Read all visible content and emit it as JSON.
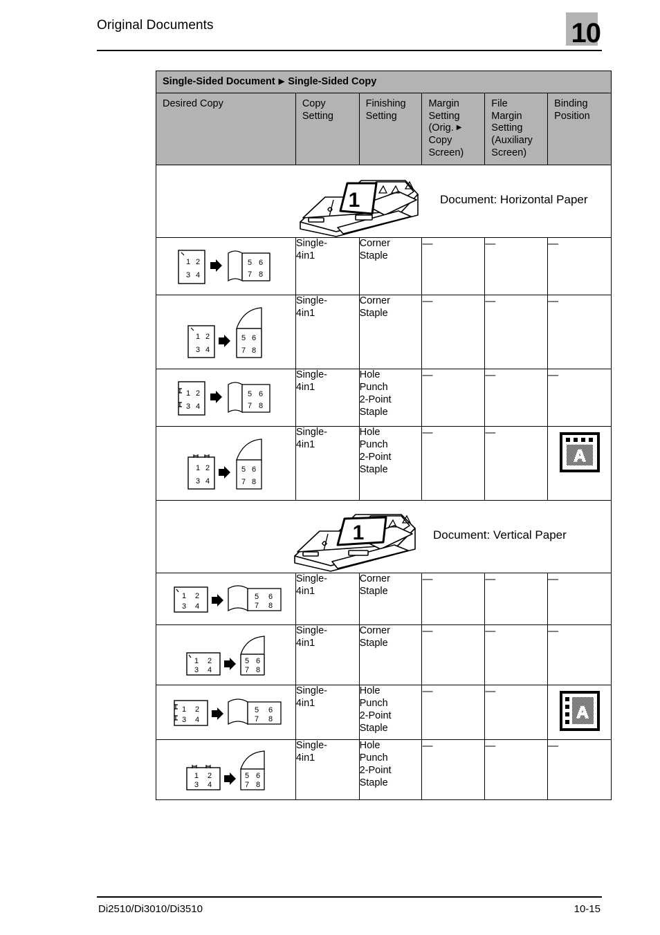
{
  "header": {
    "title": "Original Documents",
    "chapter": "10"
  },
  "footer": {
    "models": "Di2510/Di3010/Di3510",
    "page": "10-15"
  },
  "table": {
    "band_title_part1": "Single-Sided Document",
    "band_arrow": "▶",
    "band_title_part2": "Single-Sided Copy",
    "columns": [
      {
        "label": "Desired Copy"
      },
      {
        "label": "Copy\nSetting",
        "line1": "Copy",
        "line2": "Setting"
      },
      {
        "label": "Finishing\nSetting",
        "line1": "Finishing",
        "line2": "Setting"
      },
      {
        "line1": "Margin",
        "line2": "Setting",
        "line3": "(Orig.",
        "arrow": "▶",
        "line4": "Copy",
        "line5": "Screen)"
      },
      {
        "line1": "File",
        "line2": "Margin",
        "line3": "Setting",
        "line4": "(Auxiliary",
        "line5": "Screen)"
      },
      {
        "line1": "Binding",
        "line2": "Position"
      }
    ],
    "sections": [
      {
        "illustration": {
          "name": "document-feeder-horizontal",
          "page_number": "1",
          "label": "Document: Horizontal Paper"
        },
        "rows": [
          {
            "diagram": {
              "source": {
                "orientation": "portrait",
                "numbers": [
                  "1",
                  "2",
                  "3",
                  "4"
                ],
                "mark": "corner-staple-top-left"
              },
              "arrow": "➡",
              "output": {
                "style": "side-fold",
                "orientation": "portrait",
                "numbers": [
                  "5",
                  "6",
                  "7",
                  "8"
                ]
              }
            },
            "copy_setting": "Single-4in1",
            "copy_setting_l1": "Single-",
            "copy_setting_l2": "4in1",
            "finishing_setting": [
              "Corner",
              "Staple"
            ],
            "margin_setting": "—",
            "file_margin_setting": "—",
            "binding_position": "—"
          },
          {
            "diagram": {
              "source": {
                "orientation": "portrait",
                "numbers": [
                  "1",
                  "2",
                  "3",
                  "4"
                ],
                "mark": "corner-staple-top-left"
              },
              "arrow": "➡",
              "output": {
                "style": "top-fold",
                "orientation": "portrait",
                "numbers": [
                  "5",
                  "6",
                  "7",
                  "8"
                ]
              }
            },
            "copy_setting_l1": "Single-",
            "copy_setting_l2": "4in1",
            "finishing_setting": [
              "Corner",
              "Staple"
            ],
            "margin_setting": "—",
            "file_margin_setting": "—",
            "binding_position": "—"
          },
          {
            "diagram": {
              "source": {
                "orientation": "portrait",
                "numbers": [
                  "1",
                  "2",
                  "3",
                  "4"
                ],
                "mark": "two-point-staple-left"
              },
              "arrow": "➡",
              "output": {
                "style": "side-fold",
                "orientation": "portrait",
                "numbers": [
                  "5",
                  "6",
                  "7",
                  "8"
                ]
              }
            },
            "copy_setting_l1": "Single-",
            "copy_setting_l2": "4in1",
            "finishing_setting": [
              "Hole",
              "Punch",
              "2-Point",
              "Staple"
            ],
            "margin_setting": "—",
            "file_margin_setting": "—",
            "binding_position": "—"
          },
          {
            "diagram": {
              "source": {
                "orientation": "portrait",
                "numbers": [
                  "1",
                  "2",
                  "3",
                  "4"
                ],
                "mark": "two-point-staple-top"
              },
              "arrow": "➡",
              "output": {
                "style": "top-fold",
                "orientation": "portrait",
                "numbers": [
                  "5",
                  "6",
                  "7",
                  "8"
                ]
              }
            },
            "copy_setting_l1": "Single-",
            "copy_setting_l2": "4in1",
            "finishing_setting": [
              "Hole",
              "Punch",
              "2-Point",
              "Staple"
            ],
            "margin_setting": "—",
            "file_margin_setting": "—",
            "binding_position_icon": {
              "name": "binding-position-top",
              "letter": "A",
              "holes": "top",
              "hole_count": 4
            }
          }
        ]
      },
      {
        "illustration": {
          "name": "document-feeder-vertical",
          "page_number": "1",
          "label": "Document: Vertical Paper"
        },
        "rows": [
          {
            "diagram": {
              "source": {
                "orientation": "landscape",
                "numbers": [
                  "1",
                  "2",
                  "3",
                  "4"
                ],
                "mark": "corner-staple-top-left"
              },
              "arrow": "➡",
              "output": {
                "style": "side-fold",
                "orientation": "landscape",
                "numbers": [
                  "5",
                  "6",
                  "7",
                  "8"
                ]
              }
            },
            "copy_setting_l1": "Single-",
            "copy_setting_l2": "4in1",
            "finishing_setting": [
              "Corner",
              "Staple"
            ],
            "margin_setting": "—",
            "file_margin_setting": "—",
            "binding_position": "—"
          },
          {
            "diagram": {
              "source": {
                "orientation": "landscape",
                "numbers": [
                  "1",
                  "2",
                  "3",
                  "4"
                ],
                "mark": "corner-staple-top-left"
              },
              "arrow": "➡",
              "output": {
                "style": "top-fold",
                "orientation": "landscape",
                "numbers": [
                  "5",
                  "6",
                  "7",
                  "8"
                ]
              }
            },
            "copy_setting_l1": "Single-",
            "copy_setting_l2": "4in1",
            "finishing_setting": [
              "Corner",
              "Staple"
            ],
            "margin_setting": "—",
            "file_margin_setting": "—",
            "binding_position": "—"
          },
          {
            "diagram": {
              "source": {
                "orientation": "landscape",
                "numbers": [
                  "1",
                  "2",
                  "3",
                  "4"
                ],
                "mark": "two-point-staple-left"
              },
              "arrow": "➡",
              "output": {
                "style": "side-fold",
                "orientation": "landscape",
                "numbers": [
                  "5",
                  "6",
                  "7",
                  "8"
                ]
              }
            },
            "copy_setting_l1": "Single-",
            "copy_setting_l2": "4in1",
            "finishing_setting": [
              "Hole",
              "Punch",
              "2-Point",
              "Staple"
            ],
            "margin_setting": "—",
            "file_margin_setting": "—",
            "binding_position_icon": {
              "name": "binding-position-left",
              "letter": "A",
              "holes": "left",
              "hole_count": 4
            }
          },
          {
            "diagram": {
              "source": {
                "orientation": "landscape",
                "numbers": [
                  "1",
                  "2",
                  "3",
                  "4"
                ],
                "mark": "two-point-staple-top"
              },
              "arrow": "➡",
              "output": {
                "style": "top-fold",
                "orientation": "landscape",
                "numbers": [
                  "5",
                  "6",
                  "7",
                  "8"
                ]
              }
            },
            "copy_setting_l1": "Single-",
            "copy_setting_l2": "4in1",
            "finishing_setting": [
              "Hole",
              "Punch",
              "2-Point",
              "Staple"
            ],
            "margin_setting": "—",
            "file_margin_setting": "—",
            "binding_position": "—"
          }
        ]
      }
    ]
  },
  "colors": {
    "header_gray": "#b3b3b3",
    "rule": "#000000",
    "page_bg": "#ffffff"
  }
}
